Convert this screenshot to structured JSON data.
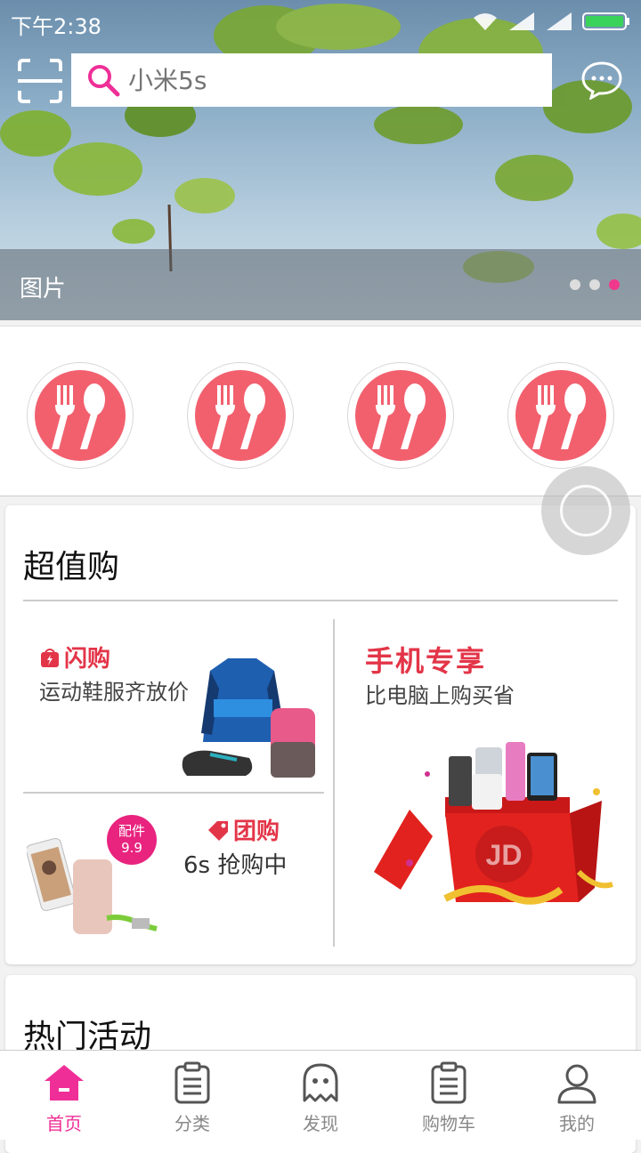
{
  "status_bar": {
    "time": "下午2:38"
  },
  "search": {
    "placeholder": "小米5s"
  },
  "banner": {
    "caption": "图片",
    "dots": 3,
    "active_dot": 3
  },
  "categories": [
    {
      "icon": "fork-spoon-icon"
    },
    {
      "icon": "fork-spoon-icon"
    },
    {
      "icon": "fork-spoon-icon"
    },
    {
      "icon": "fork-spoon-icon"
    }
  ],
  "deals": {
    "title": "超值购",
    "flash": {
      "title": "闪购",
      "subtitle": "运动鞋服齐放价"
    },
    "phone": {
      "title": "手机专享",
      "subtitle": "比电脑上购买省"
    },
    "group": {
      "title": "团购",
      "subtitle": "6s 抢购中",
      "badge_line1": "配件",
      "badge_line2": "9.9"
    },
    "gift_box_logo": "JD"
  },
  "hot": {
    "title": "热门活动"
  },
  "tabs": [
    {
      "label": "首页",
      "icon": "home-icon",
      "active": true
    },
    {
      "label": "分类",
      "icon": "clipboard-icon"
    },
    {
      "label": "发现",
      "icon": "ghost-icon"
    },
    {
      "label": "购物车",
      "icon": "clipboard-icon"
    },
    {
      "label": "我的",
      "icon": "person-icon"
    }
  ],
  "colors": {
    "accent": "#ef2f97",
    "deal_red": "#e33548",
    "category_red": "#f2606e"
  }
}
